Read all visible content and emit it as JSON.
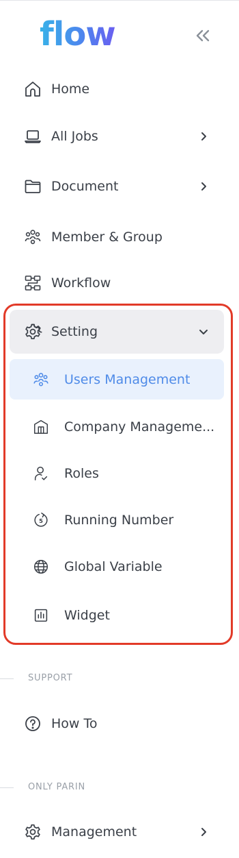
{
  "brand": {
    "logo_text": "flow"
  },
  "nav": {
    "home": "Home",
    "all_jobs": "All Jobs",
    "document": "Document",
    "member_group": "Member & Group",
    "workflow": "Workflow",
    "setting": "Setting"
  },
  "setting_submenu": {
    "users_management": "Users Management",
    "company_management": "Company Manageme...",
    "roles": "Roles",
    "running_number": "Running Number",
    "global_variable": "Global Variable",
    "widget": "Widget"
  },
  "support": {
    "heading": "SUPPORT",
    "how_to": "How To"
  },
  "only_parin": {
    "heading": "ONLY PARIN",
    "management": "Management"
  },
  "colors": {
    "accent": "#4f8be8",
    "active_bg": "#e9f1fd",
    "highlight_border": "#e23a28",
    "setting_bg": "#eeeef1"
  },
  "icons": {
    "collapse": "double-chevron-left-icon",
    "home": "home-icon",
    "all_jobs": "laptop-icon",
    "document": "folder-icon",
    "member_group": "users-group-icon",
    "workflow": "workflow-icon",
    "setting": "gear-icon",
    "users_management": "users-group-icon",
    "company_management": "building-icon",
    "roles": "user-check-icon",
    "running_number": "running-number-icon",
    "global_variable": "globe-icon",
    "widget": "bar-chart-icon",
    "how_to": "question-circle-icon",
    "management": "gear-icon"
  }
}
